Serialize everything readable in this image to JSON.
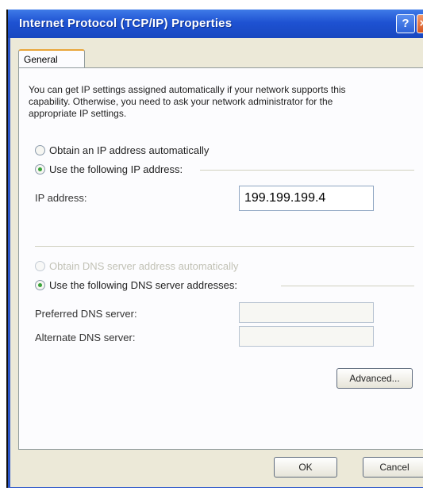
{
  "window": {
    "title": "Internet Protocol (TCP/IP) Properties",
    "help_glyph": "?",
    "close_glyph": "×"
  },
  "tabs": [
    {
      "label": "General",
      "selected": true
    }
  ],
  "general": {
    "intro": "You can get IP settings assigned automatically if your network supports this capability. Otherwise, you need to ask your network administrator for the appropriate IP settings.",
    "ip_mode": {
      "auto_label": "Obtain an IP address automatically",
      "manual_label": "Use the following IP address:",
      "selected": "manual"
    },
    "ip_address": {
      "label": "IP address:",
      "value": "199.199.199.4"
    },
    "dns_mode": {
      "auto_label": "Obtain DNS server address automatically",
      "manual_label": "Use the following DNS server addresses:",
      "selected": "manual"
    },
    "preferred_dns": {
      "label": "Preferred DNS server:",
      "value": ""
    },
    "alternate_dns": {
      "label": "Alternate DNS server:",
      "value": ""
    },
    "advanced_button": "Advanced..."
  },
  "footer": {
    "ok": "OK",
    "cancel": "Cancel"
  }
}
